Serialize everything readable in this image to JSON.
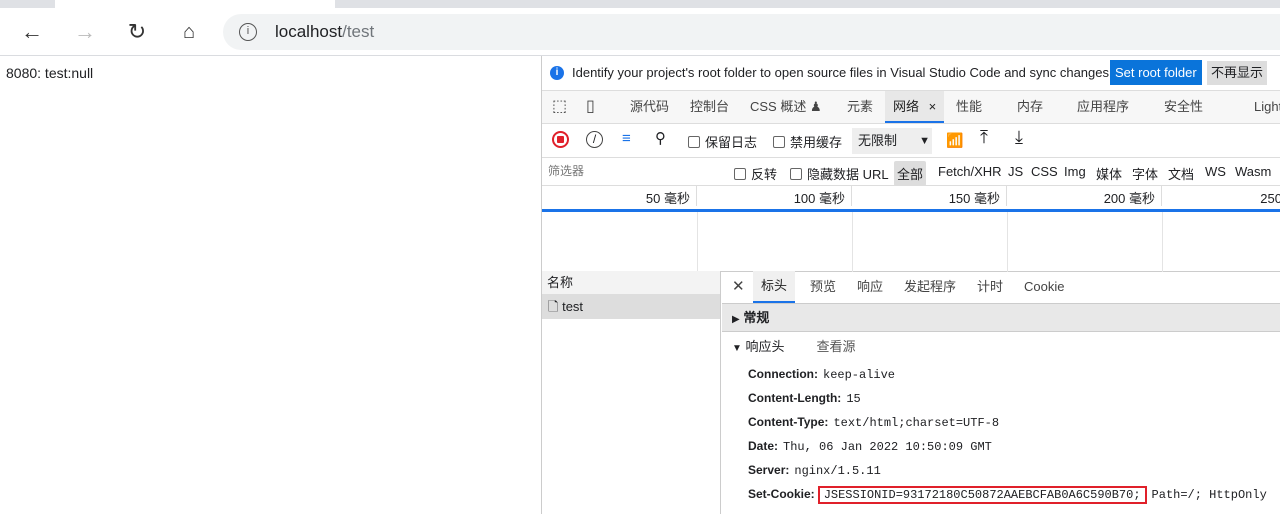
{
  "browser": {
    "url_host": "localhost",
    "url_path": "/test"
  },
  "page": {
    "text": "8080: test:null"
  },
  "devtools": {
    "infobar": {
      "message": "Identify your project's root folder to open source files in Visual Studio Code and sync changes.",
      "set_root": "Set root folder",
      "dismiss": "不再显示"
    },
    "tabs": [
      "源代码",
      "控制台",
      "CSS 概述 ♟",
      "元素",
      "网络",
      "性能",
      "内存",
      "应用程序",
      "安全性",
      "Lighthouse"
    ],
    "active_tab_close": "×",
    "controls": {
      "preserve_log": "保留日志",
      "disable_cache": "禁用缓存",
      "throttle": "无限制"
    },
    "filter": {
      "placeholder": "筛选器",
      "invert": "反转",
      "hide_data_url": "隐藏数据 URL",
      "types": [
        "全部",
        "Fetch/XHR",
        "JS",
        "CSS",
        "Img",
        "媒体",
        "字体",
        "文档",
        "WS",
        "Wasm"
      ]
    },
    "timeline": [
      "50 毫秒",
      "100 毫秒",
      "150 毫秒",
      "200 毫秒",
      "250"
    ],
    "name_header": "名称",
    "requests": [
      "test"
    ],
    "detail_tabs": [
      "标头",
      "预览",
      "响应",
      "发起程序",
      "计时",
      "Cookie"
    ],
    "general": "常规",
    "response_headers": "响应头",
    "view_source": "查看源",
    "headers": [
      {
        "k": "Connection:",
        "v": "keep-alive"
      },
      {
        "k": "Content-Length:",
        "v": "15"
      },
      {
        "k": "Content-Type:",
        "v": "text/html;charset=UTF-8"
      },
      {
        "k": "Date:",
        "v": "Thu, 06 Jan 2022 10:50:09 GMT"
      },
      {
        "k": "Server:",
        "v": "nginx/1.5.11"
      },
      {
        "k": "Set-Cookie:",
        "v": "JSESSIONID=93172180C50872AAEBCFAB0A6C590B70;",
        "extra": "Path=/; HttpOnly"
      }
    ],
    "highlight_color": "#e0202a",
    "accent": "#1a73e8"
  }
}
